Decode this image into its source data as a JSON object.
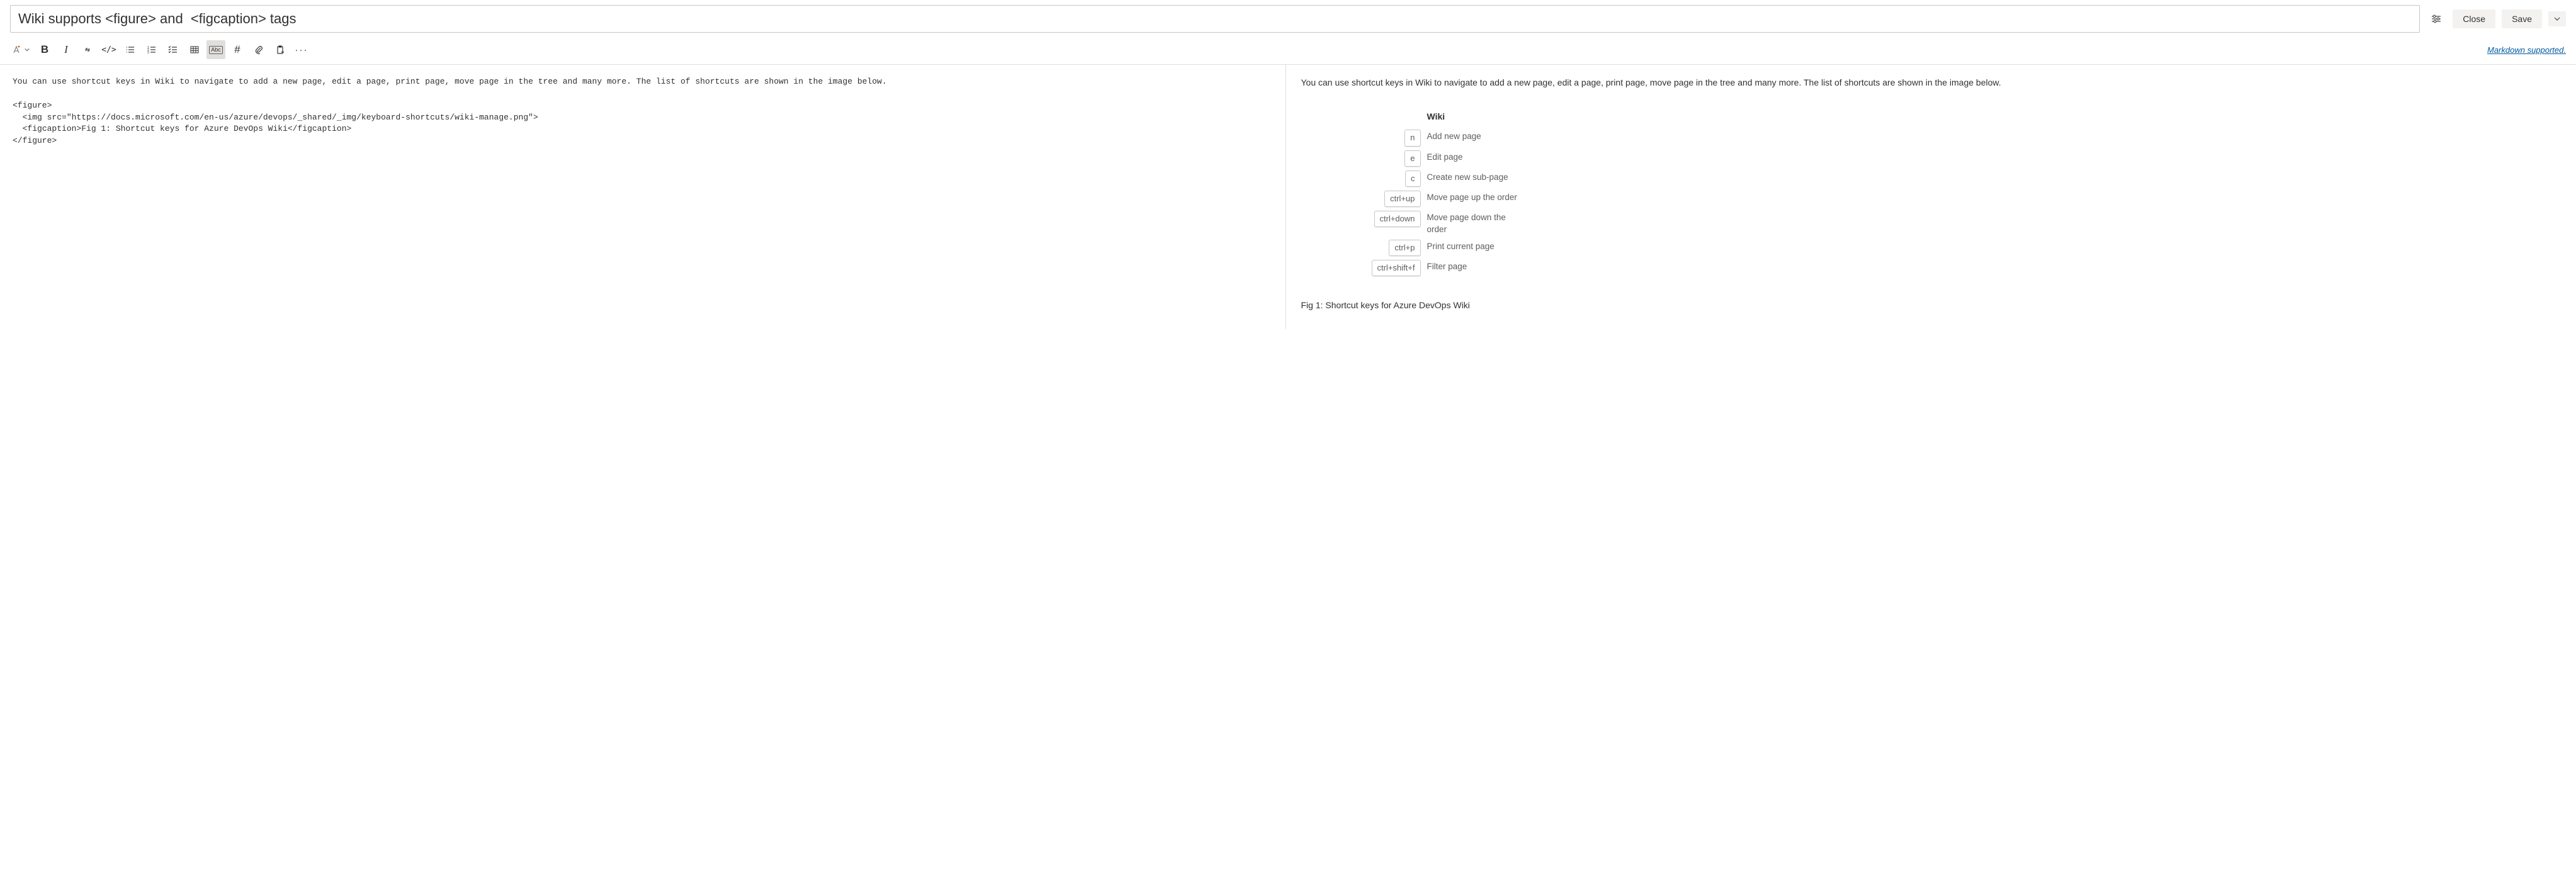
{
  "header": {
    "title_value": "Wiki supports <figure> and  <figcaption> tags",
    "close_label": "Close",
    "save_label": "Save"
  },
  "toolbar": {
    "markdown_link_label": "Markdown supported.",
    "items": [
      {
        "name": "text-format-dropdown"
      },
      {
        "name": "bold-button"
      },
      {
        "name": "italic-button"
      },
      {
        "name": "link-button"
      },
      {
        "name": "code-button"
      },
      {
        "name": "bulleted-list-button"
      },
      {
        "name": "numbered-list-button"
      },
      {
        "name": "checklist-button"
      },
      {
        "name": "table-button"
      },
      {
        "name": "mention-button",
        "active": true
      },
      {
        "name": "hash-button"
      },
      {
        "name": "attach-button"
      },
      {
        "name": "work-item-button"
      },
      {
        "name": "more-button"
      }
    ]
  },
  "source": {
    "lines": [
      "You can use shortcut keys in Wiki to navigate to add a new page, edit a page, print page, move page in the tree and many more. The list of shortcuts are shown in the image below.",
      "",
      "<figure>",
      "  <img src=\"https://docs.microsoft.com/en-us/azure/devops/_shared/_img/keyboard-shortcuts/wiki-manage.png\">",
      "  <figcaption>Fig 1: Shortcut keys for Azure DevOps Wiki</figcaption>",
      "</figure>"
    ]
  },
  "preview": {
    "intro_text": "You can use shortcut keys in Wiki to navigate to add a new page, edit a page, print page, move page in the tree and many more. The list of shortcuts are shown in the image below.",
    "shortcuts_heading": "Wiki",
    "shortcuts": [
      {
        "key": "n",
        "desc": "Add new page"
      },
      {
        "key": "e",
        "desc": "Edit page"
      },
      {
        "key": "c",
        "desc": "Create new sub-page"
      },
      {
        "key": "ctrl+up",
        "desc": "Move page up the order"
      },
      {
        "key": "ctrl+down",
        "desc": "Move page down the order"
      },
      {
        "key": "ctrl+p",
        "desc": "Print current page"
      },
      {
        "key": "ctrl+shift+f",
        "desc": "Filter page"
      }
    ],
    "figcaption": "Fig 1: Shortcut keys for Azure DevOps Wiki"
  }
}
